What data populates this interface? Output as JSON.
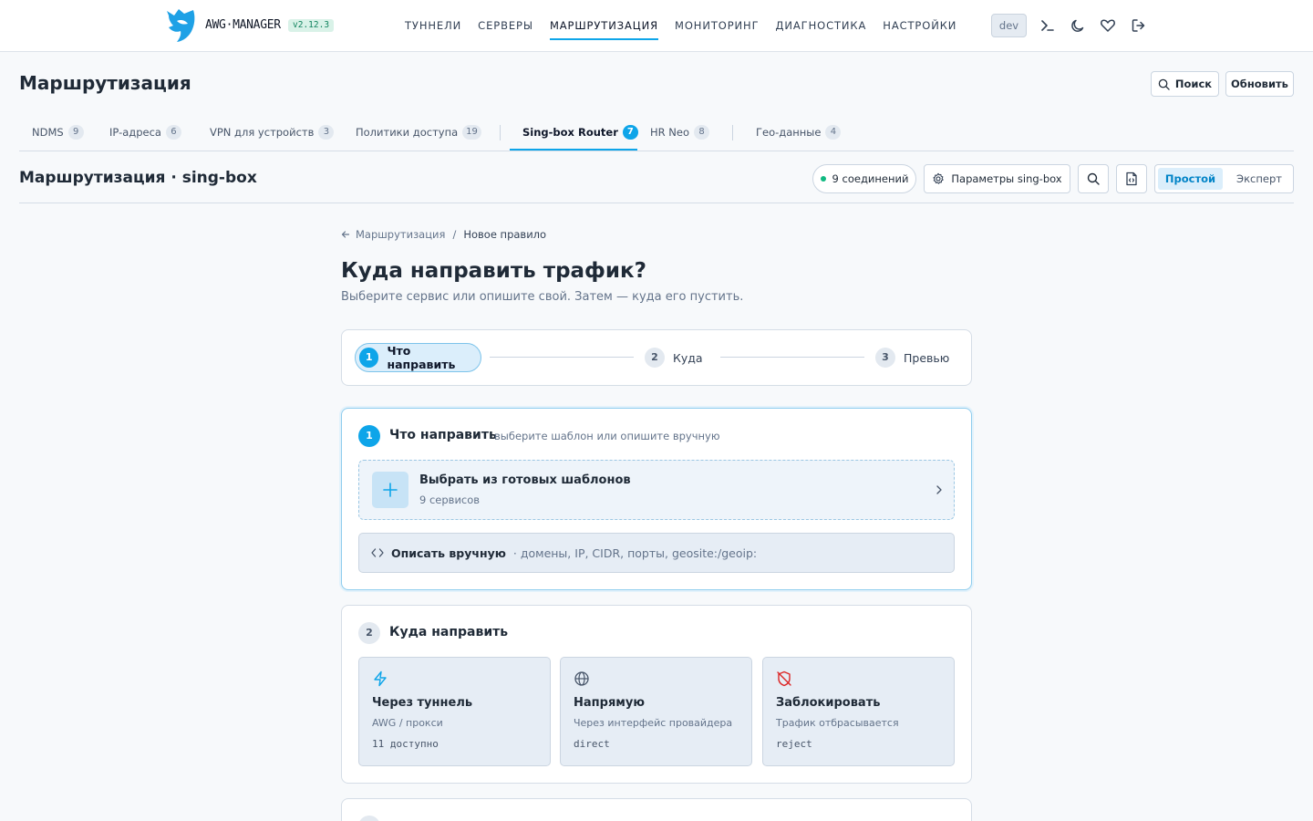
{
  "app": {
    "brand": "AWG·MANAGER",
    "version": "v2.12.3",
    "env": "dev",
    "nav": [
      "ТУННЕЛИ",
      "СЕРВЕРЫ",
      "МАРШРУТИЗАЦИЯ",
      "МОНИТОРИНГ",
      "ДИАГНОСТИКА",
      "НАСТРОЙКИ"
    ],
    "accent": "#0ea5e9"
  },
  "header": {
    "title": "Маршрутизация",
    "search_label": "Поиск",
    "refresh_label": "Обновить"
  },
  "tabs": [
    {
      "label": "NDMS",
      "count": "9"
    },
    {
      "label": "IP-адреса",
      "count": "6"
    },
    {
      "label": "VPN для устройств",
      "count": "3"
    },
    {
      "label": "Политики доступа",
      "count": "19"
    },
    {
      "label": "Sing-box Router",
      "count": "7"
    },
    {
      "label": "HR Neo",
      "count": "8"
    },
    {
      "label": "Гео-данные",
      "count": "4"
    }
  ],
  "subheader": {
    "title": "Маршрутизация · sing-box",
    "connections": "9 соединений",
    "settings_label": "Параметры sing-box",
    "mode_simple": "Простой",
    "mode_expert": "Эксперт"
  },
  "breadcrumb": {
    "back": "Маршрутизация",
    "separator": "/",
    "current": "Новое правило"
  },
  "main": {
    "title": "Куда направить трафик?",
    "subtitle": "Выберите сервис или опишите свой. Затем — куда его пустить."
  },
  "stepper": [
    {
      "num": "1",
      "label": "Что направить"
    },
    {
      "num": "2",
      "label": "Куда"
    },
    {
      "num": "3",
      "label": "Превью"
    }
  ],
  "section1": {
    "num": "1",
    "title": "Что направить",
    "hint": "выберите шаблон или опишите вручную",
    "templates_title": "Выбрать из готовых шаблонов",
    "templates_sub": "9 сервисов",
    "manual_label": "Описать вручную",
    "manual_hint": "· домены, IP, CIDR, порты, geosite:/geoip:"
  },
  "section2": {
    "num": "2",
    "title": "Куда направить",
    "options": [
      {
        "title": "Через туннель",
        "desc": "AWG / прокси",
        "code": "11 доступно",
        "icon": "zap-icon"
      },
      {
        "title": "Напрямую",
        "desc": "Через интерфейс провайдера",
        "code": "direct",
        "icon": "globe-icon"
      },
      {
        "title": "Заблокировать",
        "desc": "Трафик отбрасывается",
        "code": "reject",
        "icon": "shield-off-icon"
      }
    ]
  }
}
